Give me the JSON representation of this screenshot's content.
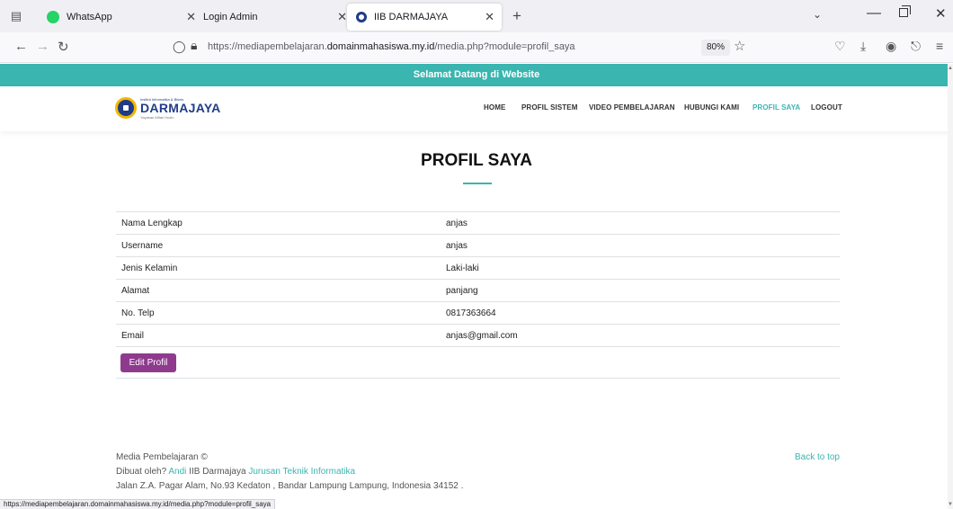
{
  "browser": {
    "tabs": [
      {
        "title": "WhatsApp",
        "favicon": "whatsapp-icon",
        "favicon_color": "#25d366"
      },
      {
        "title": "Login Admin",
        "favicon": "",
        "favicon_color": ""
      },
      {
        "title": "IIB DARMAJAYA",
        "favicon": "darmajaya-icon",
        "favicon_color": "#1f3c88"
      }
    ],
    "url_prefix": "https://mediapembelajaran.",
    "url_domain": "domainmahasiswa.my.id",
    "url_path": "/media.php?module=profil_saya",
    "zoom": "80%",
    "status_url": "https://mediapembelajaran.domainmahasiswa.my.id/media.php?module=profil_saya"
  },
  "site": {
    "welcome": "Selamat Datang di Website",
    "logo": {
      "small": "Institut Informatika & Bisnis",
      "main": "DARMAJAYA",
      "tagline": "Yayasan Alfian Husin"
    },
    "menu": [
      "HOME",
      "PROFIL SISTEM",
      "VIDEO PEMBELAJARAN",
      "HUBUNGI KAMI",
      "PROFIL SAYA",
      "LOGOUT"
    ],
    "active_menu": "PROFIL SAYA",
    "accent_color": "#3ab5b0",
    "button_color": "#8e3b8e"
  },
  "profile": {
    "title": "PROFIL SAYA",
    "rows": [
      {
        "label": "Nama Lengkap",
        "value": "anjas"
      },
      {
        "label": "Username",
        "value": "anjas"
      },
      {
        "label": "Jenis Kelamin",
        "value": "Laki-laki"
      },
      {
        "label": "Alamat",
        "value": "panjang"
      },
      {
        "label": "No. Telp",
        "value": "0817363664"
      },
      {
        "label": "Email",
        "value": "anjas@gmail.com"
      }
    ],
    "edit_button": "Edit Profil"
  },
  "footer": {
    "copyright": "Media Pembelajaran ©",
    "made_by_prefix": "Dibuat oleh?",
    "author": "Andi",
    "institution": "IIB Darmajaya",
    "department": "Jurusan Teknik Informatika",
    "address": "Jalan Z.A. Pagar Alam, No.93 Kedaton , Bandar Lampung Lampung, Indonesia 34152 .",
    "back_to_top": "Back to top"
  }
}
